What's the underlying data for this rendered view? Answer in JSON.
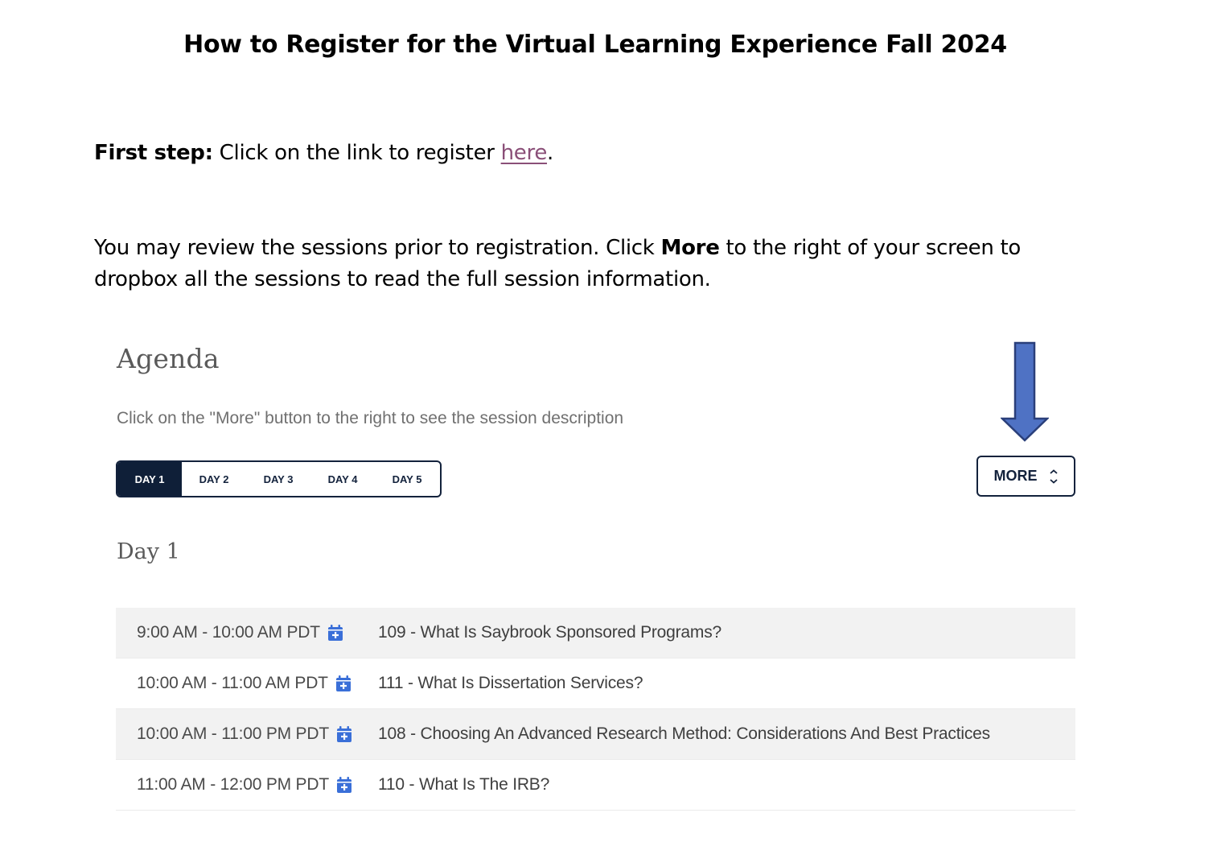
{
  "document": {
    "title": "How to Register for the Virtual Learning Experience Fall 2024",
    "first_step": {
      "label": "First step:",
      "text": " Click on the link to register ",
      "link_text": "here",
      "after": "."
    },
    "review": {
      "before": "You may review the sessions prior to registration. Click ",
      "bold": "More",
      "after": " to the right of your screen to dropbox all the sessions to read the full session information."
    }
  },
  "agenda": {
    "heading": "Agenda",
    "subtitle": "Click on the \"More\" button to the right to see the session description",
    "tabs": [
      {
        "label": "DAY 1",
        "active": true
      },
      {
        "label": "DAY 2",
        "active": false
      },
      {
        "label": "DAY 3",
        "active": false
      },
      {
        "label": "DAY 4",
        "active": false
      },
      {
        "label": "DAY 5",
        "active": false
      }
    ],
    "more_label": "MORE",
    "day_heading": "Day 1",
    "sessions": [
      {
        "time": "9:00 AM - 10:00 AM PDT",
        "title": "109 - What Is Saybrook Sponsored Programs?"
      },
      {
        "time": "10:00 AM - 11:00 AM PDT",
        "title": "111 - What Is Dissertation Services?"
      },
      {
        "time": "10:00 AM - 11:00 PM PDT",
        "title": "108 - Choosing An Advanced Research Method: Considerations And Best Practices"
      },
      {
        "time": "11:00 AM - 12:00 PM PDT",
        "title": "110 - What Is The IRB?"
      }
    ],
    "icons": {
      "calendar": "calendar-add-icon",
      "chevron": "chevron-up-down-icon",
      "arrow": "down-arrow-icon"
    }
  },
  "colors": {
    "navy": "#13223c",
    "link": "#8a4f78",
    "arrow_fill": "#4f72c4",
    "arrow_stroke": "#2a3f7a",
    "calendar_icon": "#3a6fd8",
    "row_alt": "#f2f2f2"
  }
}
